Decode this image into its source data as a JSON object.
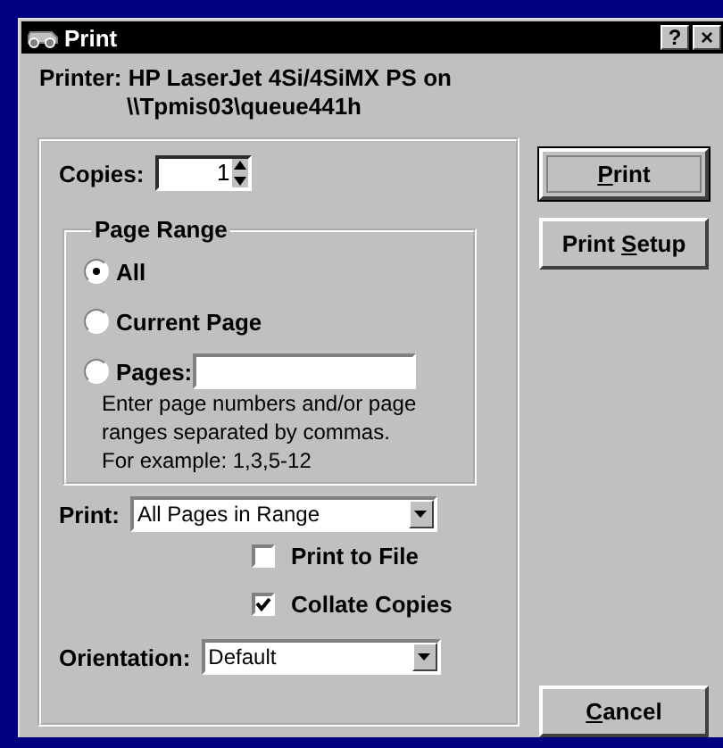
{
  "window": {
    "title": "Print",
    "controls": [
      "?",
      "×"
    ]
  },
  "printer": [
    "Printer: HP LaserJet 4Si/4SiMX PS on",
    "\\\\Tpmis03\\queue441h"
  ],
  "copies": {
    "label": "Copies:",
    "value": "1"
  },
  "page_range": {
    "title": "Page Range",
    "options": [
      {
        "label": "All",
        "selected": true,
        "kind": "plain"
      },
      {
        "label": "Current Page",
        "selected": false,
        "kind": "plain"
      },
      {
        "label": "Pages:",
        "selected": false,
        "kind": "field"
      }
    ],
    "hint": "Enter page numbers and/or page ranges separated by commas. For example: 1,3,5-12"
  },
  "print_select": {
    "label": "Print:",
    "value": "All Pages in Range"
  },
  "checkboxes": [
    {
      "label": "Print to File",
      "checked": false
    },
    {
      "label": "Collate Copies",
      "checked": true
    }
  ],
  "orientation": {
    "label": "Orientation:",
    "value": "Default"
  },
  "buttons": [
    {
      "parts": [
        {
          "text": "P",
          "underlined": true
        },
        {
          "text": "rint",
          "underlined": false
        }
      ],
      "default": true
    },
    {
      "parts": [
        {
          "text": "Print ",
          "underlined": false
        },
        {
          "text": "S",
          "underlined": true
        },
        {
          "text": "etup",
          "underlined": false
        }
      ],
      "default": false
    },
    {
      "parts": [
        {
          "text": "C",
          "underlined": true
        },
        {
          "text": "ancel",
          "underlined": false
        }
      ],
      "default": false
    }
  ]
}
